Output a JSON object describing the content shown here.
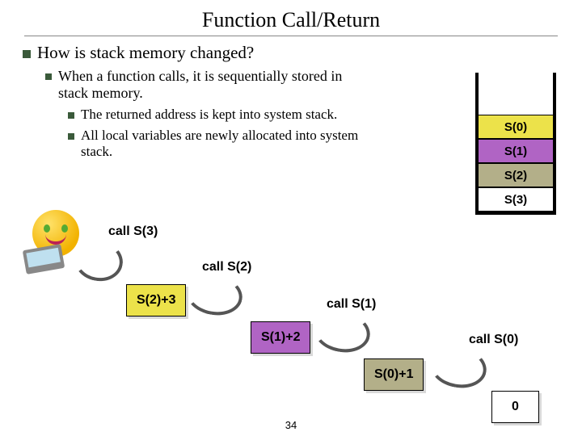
{
  "title": "Function Call/Return",
  "q": "How is stack memory changed?",
  "p1": "When a function calls, it is sequentially stored in stack memory.",
  "p1a": "The returned address is kept into system stack.",
  "p1b": "All local variables are newly allocated into system stack.",
  "stack": {
    "c0": "S(0)",
    "c1": "S(1)",
    "c2": "S(2)",
    "c3": "S(3)"
  },
  "calls": {
    "s3": "call S(3)",
    "s2": "call S(2)",
    "s1": "call S(1)",
    "s0": "call S(0)"
  },
  "rets": {
    "r2": "S(2)+3",
    "r1": "S(1)+2",
    "r0": "S(0)+1",
    "z": "0"
  },
  "page": "34"
}
